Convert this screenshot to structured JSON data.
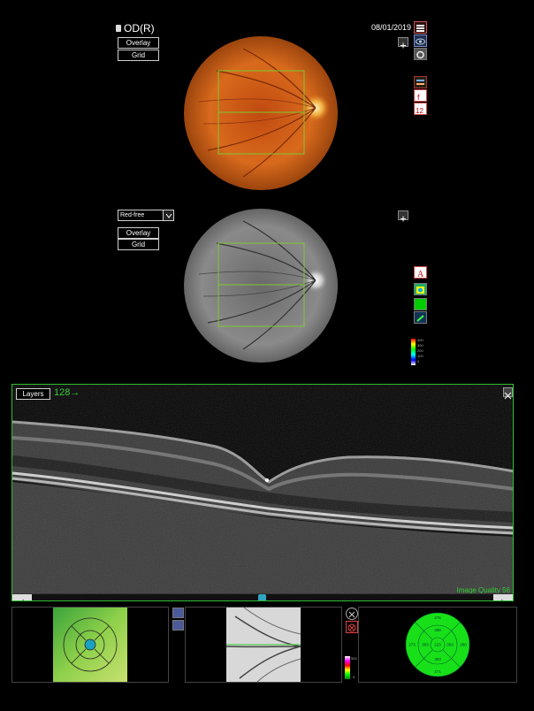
{
  "header": {
    "eye": "OD(R)",
    "date": "08/01/2019"
  },
  "fundus_top": {
    "overlay_label": "Overlay",
    "grid_label": "Grid"
  },
  "fundus_bottom": {
    "filter_selected": "Red-free",
    "overlay_label": "Overlay",
    "grid_label": "Grid"
  },
  "oct": {
    "layers_label": "Layers",
    "slice_indicator": "128→",
    "image_quality": "Image Quality 56",
    "scroll_position": 0.5
  },
  "colors": {
    "accent_green": "#32cd32",
    "frame_green": "#2fbf2f",
    "etdrs_fill": "#18e018"
  },
  "etdrs_values": {
    "superior_outer": "276",
    "superior_inner": "308",
    "center": "223",
    "temporal_outer": "273",
    "temporal_inner": "303",
    "nasal_inner": "303",
    "nasal_outer": "280",
    "inferior_inner": "303",
    "inferior_outer": "271"
  },
  "thickness_scale": {
    "top": "500",
    "bottom": "0"
  },
  "fundus_scale_labels": [
    "400",
    "300",
    "200",
    "100",
    "0"
  ],
  "icons": [
    "camera-icon",
    "report-icon",
    "eye-icon",
    "settings-icon",
    "layers-icon",
    "marker-icon",
    "measure-icon",
    "text-annotation-icon",
    "thickness-map-icon",
    "green-map-icon",
    "crosshair-icon",
    "expand-icon",
    "scroll-left-icon",
    "scroll-right-icon"
  ]
}
